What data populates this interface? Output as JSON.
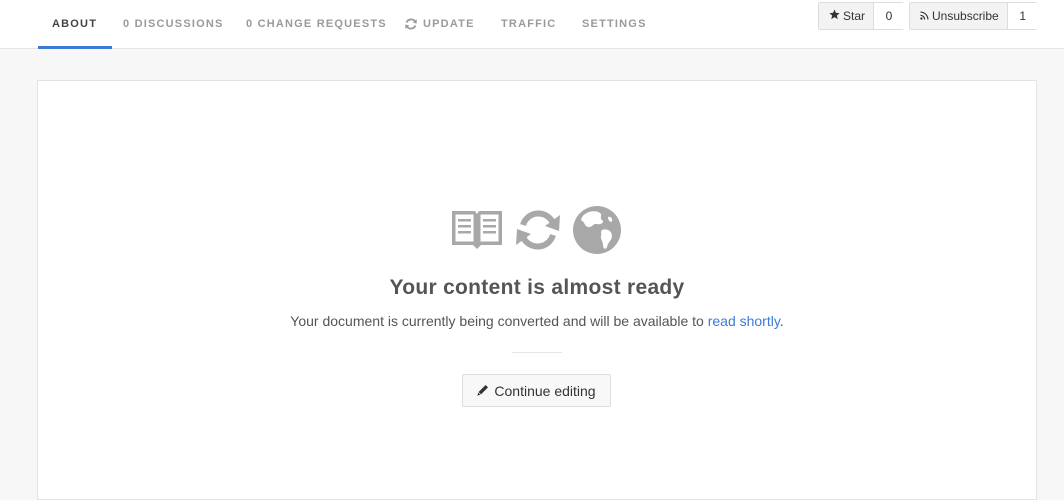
{
  "tabs": [
    {
      "label": "ABOUT"
    },
    {
      "label": "0 DISCUSSIONS"
    },
    {
      "label": "0 CHANGE REQUESTS"
    },
    {
      "label": "UPDATE",
      "icon": "refresh-icon"
    },
    {
      "label": "TRAFFIC"
    },
    {
      "label": "SETTINGS"
    }
  ],
  "actions": {
    "star": {
      "label": "Star",
      "count": "0",
      "icon": "star-icon"
    },
    "unsubscribe": {
      "label": "Unsubscribe",
      "count": "1",
      "icon": "rss-icon"
    }
  },
  "main": {
    "title": "Your content is almost ready",
    "message": "Your document is currently being converted and will be available to ",
    "link_text": "read shortly",
    "message_end": ".",
    "continue_label": "Continue editing",
    "icons": [
      "book-icon",
      "refresh-icon",
      "globe-icon"
    ]
  },
  "colors": {
    "accent": "#3b7bd4",
    "icon_gray": "#a8a8a8",
    "background": "#f7f7f7"
  }
}
